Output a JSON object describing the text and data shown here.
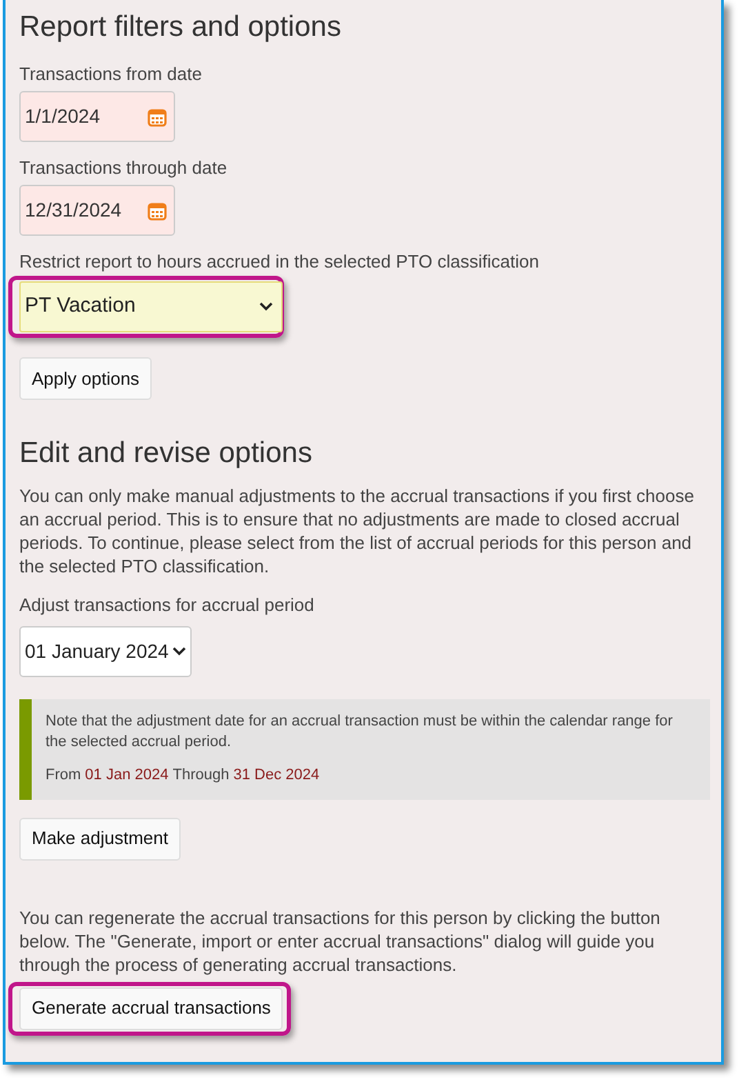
{
  "filters": {
    "heading": "Report filters and options",
    "from_date": {
      "label": "Transactions from date",
      "value": "1/1/2024"
    },
    "through_date": {
      "label": "Transactions through date",
      "value": "12/31/2024"
    },
    "classification": {
      "label": "Restrict report to hours accrued in the selected PTO classification",
      "value": "PT Vacation",
      "highlighted": true
    },
    "apply_button": {
      "label": "Apply options",
      "highlighted": false
    }
  },
  "edit": {
    "heading": "Edit and revise options",
    "intro": "You can only make manual adjustments to the accrual transactions if you first choose an accrual period. This is to ensure that no adjustments are made to closed accrual periods. To continue, please select from the list of accrual periods for this person and the selected PTO classification.",
    "period": {
      "label": "Adjust transactions for accrual period",
      "value": "01 January 2024",
      "highlighted": false
    },
    "note": {
      "text": "Note that the adjustment date for an accrual transaction must be within the calendar range for the selected accrual period.",
      "from_label": "From",
      "from_date": "01 Jan 2024",
      "through_label": "Through",
      "through_date": "31 Dec 2024"
    },
    "adjust_button": {
      "label": "Make adjustment",
      "highlighted": false
    },
    "regenerate_text": "You can regenerate the accrual transactions for this person by clicking the button below. The \"Generate, import or enter accrual transactions\" dialog will guide you through the process of generating accrual transactions.",
    "generate_button": {
      "label": "Generate accrual transactions",
      "highlighted": true
    }
  }
}
